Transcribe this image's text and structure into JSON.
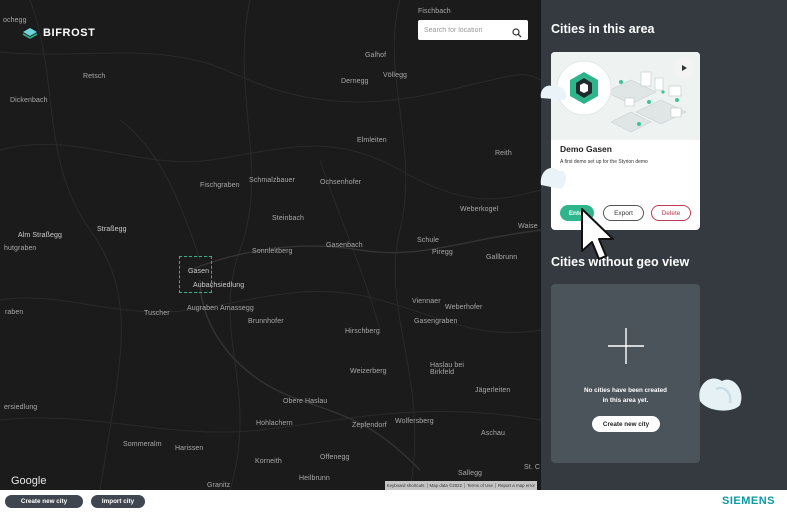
{
  "app": {
    "logo_text": "BIFROST"
  },
  "search": {
    "placeholder": "Search for location",
    "icon": "search-icon"
  },
  "map": {
    "attribution_logo": "Google",
    "attribution_links": [
      "Keyboard shortcuts",
      "Map data ©2022",
      "Terms of Use",
      "Report a map error"
    ],
    "places": [
      {
        "id": "p0",
        "name": "ochegg"
      },
      {
        "id": "p1",
        "name": "Fischbach"
      },
      {
        "id": "p2",
        "name": "Galhof"
      },
      {
        "id": "p3",
        "name": "Retsch"
      },
      {
        "id": "p4",
        "name": "Dernegg"
      },
      {
        "id": "p5",
        "name": "Völlegg"
      },
      {
        "id": "p6",
        "name": "Dickenbach"
      },
      {
        "id": "p7",
        "name": "Elmleiten"
      },
      {
        "id": "p8",
        "name": "Reith"
      },
      {
        "id": "p9",
        "name": "Schmalzbauer"
      },
      {
        "id": "p10",
        "name": "Fischgraben"
      },
      {
        "id": "p11",
        "name": "Ochsenhofer"
      },
      {
        "id": "p12",
        "name": "Weberkogel"
      },
      {
        "id": "p13",
        "name": "Steinbach"
      },
      {
        "id": "p14",
        "name": "Waise"
      },
      {
        "id": "p15",
        "name": "Straßegg"
      },
      {
        "id": "p16",
        "name": "Alm Straßegg"
      },
      {
        "id": "p17",
        "name": "hutgraben"
      },
      {
        "id": "p18",
        "name": "Schule"
      },
      {
        "id": "p19",
        "name": "Gasenbach"
      },
      {
        "id": "p20",
        "name": "Sonnleitberg"
      },
      {
        "id": "p21",
        "name": "Piregg"
      },
      {
        "id": "p22",
        "name": "Gallbrunn"
      },
      {
        "id": "p23",
        "name": "Gasen"
      },
      {
        "id": "p24",
        "name": "Aubachsiedlung"
      },
      {
        "id": "p25",
        "name": "Viennaer"
      },
      {
        "id": "p26",
        "name": "Weberhofer"
      },
      {
        "id": "p27",
        "name": "raben"
      },
      {
        "id": "p28",
        "name": "Tuscher"
      },
      {
        "id": "p29",
        "name": "Augraben"
      },
      {
        "id": "p30",
        "name": "Amassegg"
      },
      {
        "id": "p31",
        "name": "Brunnhofer"
      },
      {
        "id": "p32",
        "name": "Gasengraben"
      },
      {
        "id": "p33",
        "name": "Hirschberg"
      },
      {
        "id": "p34",
        "name": "Haslau bei Birkfeld"
      },
      {
        "id": "p35",
        "name": "Weizerberg"
      },
      {
        "id": "p36",
        "name": "Jägerleiten"
      },
      {
        "id": "p37",
        "name": "Obere Haslau"
      },
      {
        "id": "p38",
        "name": "ersiedlung"
      },
      {
        "id": "p39",
        "name": "Hohlachern"
      },
      {
        "id": "p40",
        "name": "Zepfendorf"
      },
      {
        "id": "p41",
        "name": "Wolfersberg"
      },
      {
        "id": "p42",
        "name": "Aschau"
      },
      {
        "id": "p43",
        "name": "Sommeralm"
      },
      {
        "id": "p44",
        "name": "Harissen"
      },
      {
        "id": "p45",
        "name": "Offenegg"
      },
      {
        "id": "p46",
        "name": "Korneith"
      },
      {
        "id": "p47",
        "name": "Heilbrunn"
      },
      {
        "id": "p48",
        "name": "Sallegg"
      },
      {
        "id": "p49",
        "name": "Granitz"
      },
      {
        "id": "p50",
        "name": "St. C"
      }
    ]
  },
  "panel": {
    "section_title": "Cities in this area",
    "card": {
      "title": "Demo Gasen",
      "description": "A first demo set up for the Styrion demo",
      "enter_label": "Enter",
      "export_label": "Export",
      "delete_label": "Delete"
    },
    "no_geo_title": "Cities without geo view",
    "empty": {
      "message_line1": "No cities have been created",
      "message_line2": "in this area yet.",
      "create_label": "Create new city"
    }
  },
  "bottom": {
    "create_label": "Create new city",
    "import_label": "Import city",
    "brand": "SIEMENS"
  },
  "colors": {
    "accent": "#2fb58c",
    "panel_bg": "#343a40",
    "map_bg": "#1b1b1b",
    "delete": "#c23a4f",
    "brand": "#0b9aa3"
  }
}
